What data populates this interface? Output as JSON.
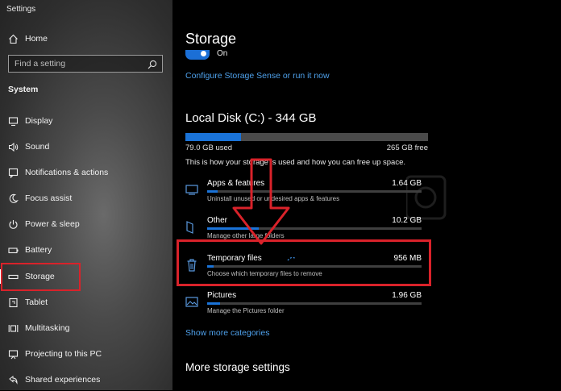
{
  "window": {
    "title": "Settings"
  },
  "sidebar": {
    "home_label": "Home",
    "search_placeholder": "Find a setting",
    "section_title": "System",
    "items": [
      {
        "label": "Display",
        "icon": "monitor-icon"
      },
      {
        "label": "Sound",
        "icon": "speaker-icon"
      },
      {
        "label": "Notifications & actions",
        "icon": "notification-icon"
      },
      {
        "label": "Focus assist",
        "icon": "moon-icon"
      },
      {
        "label": "Power & sleep",
        "icon": "power-icon"
      },
      {
        "label": "Battery",
        "icon": "battery-icon"
      },
      {
        "label": "Storage",
        "icon": "storage-icon",
        "selected": true
      },
      {
        "label": "Tablet",
        "icon": "tablet-icon"
      },
      {
        "label": "Multitasking",
        "icon": "multitasking-icon"
      },
      {
        "label": "Projecting to this PC",
        "icon": "projector-icon"
      },
      {
        "label": "Shared experiences",
        "icon": "shared-icon"
      }
    ]
  },
  "main": {
    "title": "Storage",
    "storage_sense": {
      "toggle_label": "On",
      "toggle_on": true
    },
    "configure_link": "Configure Storage Sense or run it now",
    "disk": {
      "title": "Local Disk (C:) - 344 GB",
      "used": "79.0 GB used",
      "free": "265 GB free",
      "used_fraction": 0.23
    },
    "description": "This is how your storage is used and how you can free up space.",
    "categories": [
      {
        "name": "Apps & features",
        "size": "1.64 GB",
        "subtitle": "Uninstall unused or undesired apps & features",
        "fraction": 0.05,
        "icon": "apps-icon"
      },
      {
        "name": "Other",
        "size": "10.2 GB",
        "subtitle": "Manage other large folders",
        "fraction": 0.24,
        "icon": "folder-icon"
      },
      {
        "name": "Temporary files",
        "size": "956 MB",
        "subtitle": "Choose which temporary files to remove",
        "fraction": 0.03,
        "icon": "trash-icon",
        "highlighted": true
      },
      {
        "name": "Pictures",
        "size": "1.96 GB",
        "subtitle": "Manage the Pictures folder",
        "fraction": 0.06,
        "icon": "pictures-icon"
      }
    ],
    "show_more_link": "Show more categories",
    "more_settings_title": "More storage settings"
  },
  "colors": {
    "accent": "#1a73d8",
    "link": "#4ea0ea",
    "highlight": "#d9222a"
  }
}
